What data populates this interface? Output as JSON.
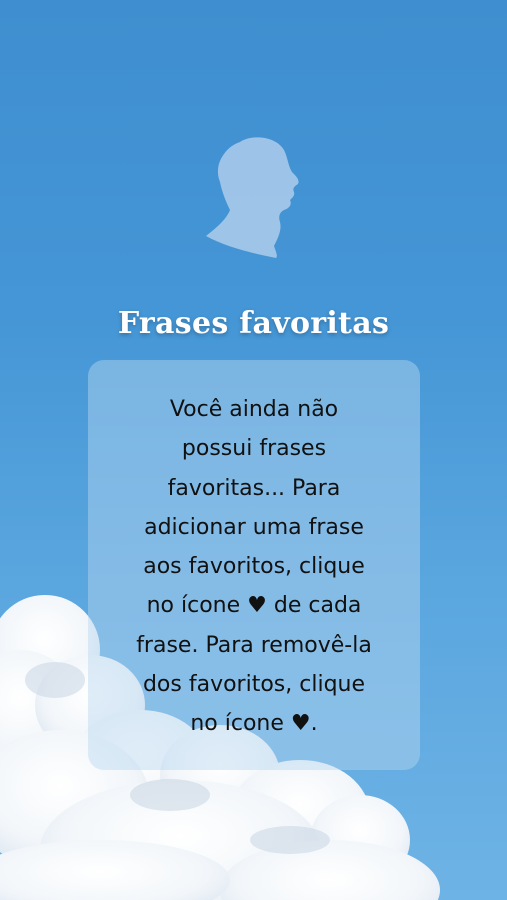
{
  "screen": {
    "title": "Frases favoritas",
    "background_color": "#4596d6",
    "text_color": "#111111"
  },
  "avatar": {
    "icon": "author-silhouette-icon"
  },
  "empty_state": {
    "lines": [
      "Você ainda não",
      "possui frases",
      "favoritas... Para",
      "adicionar uma frase",
      "aos favoritos, clique",
      "no ícone",
      "de cada",
      "frase. Para removê-la",
      "dos favoritos, clique",
      "no ícone",
      "."
    ],
    "heart_glyph": "♥",
    "heart_icon": "heart-icon"
  }
}
